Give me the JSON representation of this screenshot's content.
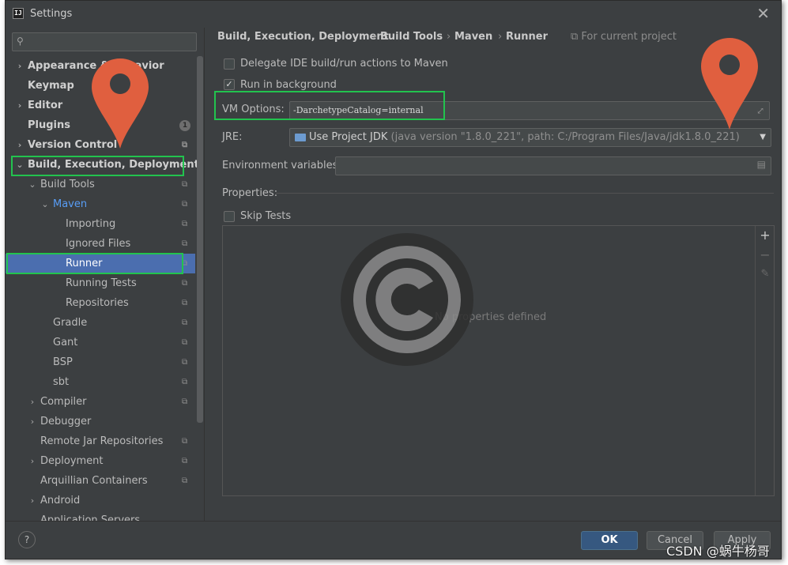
{
  "window": {
    "title": "Settings",
    "app_icon_text": "IJ"
  },
  "sidebar": {
    "search_placeholder": "",
    "items": [
      {
        "label": "Appearance & Behavior",
        "level": 0,
        "expandable": true,
        "bold": true
      },
      {
        "label": "Keymap",
        "level": 0,
        "expandable": false,
        "bold": true
      },
      {
        "label": "Editor",
        "level": 0,
        "expandable": true,
        "bold": true
      },
      {
        "label": "Plugins",
        "level": 0,
        "expandable": false,
        "bold": true,
        "badge": "1"
      },
      {
        "label": "Version Control",
        "level": 0,
        "expandable": true,
        "bold": true,
        "copy_icon": true
      },
      {
        "label": "Build, Execution, Deployment",
        "level": 0,
        "expanded": true,
        "bold": true
      },
      {
        "label": "Build Tools",
        "level": 1,
        "expanded": true,
        "copy_icon": true
      },
      {
        "label": "Maven",
        "level": 2,
        "expanded": true,
        "link": true,
        "copy_icon": true
      },
      {
        "label": "Importing",
        "level": 3,
        "copy_icon": true
      },
      {
        "label": "Ignored Files",
        "level": 3,
        "copy_icon": true
      },
      {
        "label": "Runner",
        "level": 3,
        "selected": true,
        "copy_icon": true
      },
      {
        "label": "Running Tests",
        "level": 3,
        "copy_icon": true
      },
      {
        "label": "Repositories",
        "level": 3,
        "copy_icon": true
      },
      {
        "label": "Gradle",
        "level": 2,
        "copy_icon": true
      },
      {
        "label": "Gant",
        "level": 2,
        "copy_icon": true
      },
      {
        "label": "BSP",
        "level": 2,
        "copy_icon": true
      },
      {
        "label": "sbt",
        "level": 2,
        "copy_icon": true
      },
      {
        "label": "Compiler",
        "level": 1,
        "expandable": true,
        "copy_icon": true
      },
      {
        "label": "Debugger",
        "level": 1,
        "expandable": true
      },
      {
        "label": "Remote Jar Repositories",
        "level": 1,
        "copy_icon": true
      },
      {
        "label": "Deployment",
        "level": 1,
        "expandable": true,
        "copy_icon": true
      },
      {
        "label": "Arquillian Containers",
        "level": 1,
        "copy_icon": true
      },
      {
        "label": "Android",
        "level": 1,
        "expandable": true
      },
      {
        "label": "Application Servers",
        "level": 1
      }
    ]
  },
  "breadcrumb": {
    "parts": [
      "Build, Execution, Deployment",
      "Build Tools",
      "Maven",
      "Runner"
    ],
    "scope_note": "For current project"
  },
  "runner": {
    "delegate_label": "Delegate IDE build/run actions to Maven",
    "delegate_checked": false,
    "background_label": "Run in background",
    "background_checked": true,
    "vm_options_label": "VM Options:",
    "vm_options_value": "-DarchetypeCatalog=internal",
    "jre_label": "JRE:",
    "jre_value": "Use Project JDK",
    "jre_detail": "(java version \"1.8.0_221\", path: C:/Program Files/Java/jdk1.8.0_221)",
    "env_label": "Environment variables:",
    "env_value": "",
    "properties_label": "Properties:",
    "skip_tests_label": "Skip Tests",
    "skip_tests_checked": false,
    "empty_text": "No properties defined"
  },
  "footer": {
    "help": "?",
    "ok": "OK",
    "cancel": "Cancel",
    "apply": "Apply"
  },
  "watermark": "CSDN @蜗牛杨哥",
  "colors": {
    "accent_selected": "#4b6eaf",
    "highlight_box": "#22c34e",
    "pin": "#e05f3f",
    "link": "#589df6"
  }
}
